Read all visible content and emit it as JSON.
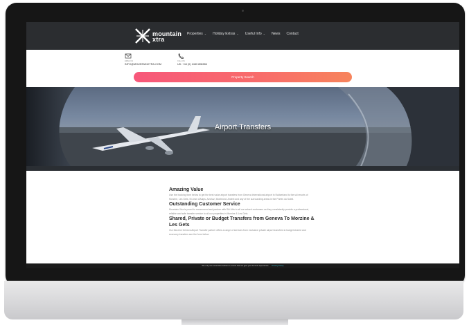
{
  "nav": {
    "logo_line1": "mountain",
    "logo_line2": "xtra",
    "items": [
      {
        "label": "Properties",
        "has_caret": true
      },
      {
        "label": "Holiday Extras",
        "has_caret": true
      },
      {
        "label": "Useful Info",
        "has_caret": true
      },
      {
        "label": "News",
        "has_caret": false
      },
      {
        "label": "Contact",
        "has_caret": false
      }
    ]
  },
  "contact": {
    "email_label": "EMAIL US",
    "email_value": "INFO@MOUNTAINXTRA.COM",
    "phone_label": "CALL US",
    "phone_value": "UK: +44 (0) 1483 808386"
  },
  "search": {
    "label": "Property Search"
  },
  "hero": {
    "title": "Airport Transfers"
  },
  "content": {
    "sections": [
      {
        "heading": "Amazing Value",
        "body": "Use the booking form below to get the best value airport transfers from Geneva International airport in Switzerland to the ski resorts of Morzine, Les Gets, St Jean d'Aulps, Avoriaz, Montriond, Ardent and any of the surrounding areas in the Portes du Soleil."
      },
      {
        "heading": "Outstanding Customer Service",
        "body": "Mountain Xtra is proud to recommend and partner with Ski Lifts to all our valued customers as they consistently provide a professional, reliable and safe transfer service to all our properties in Morzine & Les Gets."
      },
      {
        "heading": "Shared, Private or Budget Transfers from Geneva To Morzine & Les Gets",
        "body": "Our Morzine Geneva Airport Transfer partner offers a range of services from exclusive private airport transfers to budget shared and economy transfers see the form below"
      }
    ]
  },
  "cookie": {
    "text": "We only use essential cookies to ensure that we give you the best experience.",
    "policy_link": "Privacy Policy"
  },
  "colors": {
    "nav_bg": "#2b2d30",
    "search_gradient_start": "#f7577a",
    "search_gradient_end": "#f7845c",
    "policy_link": "#39b8c8"
  }
}
